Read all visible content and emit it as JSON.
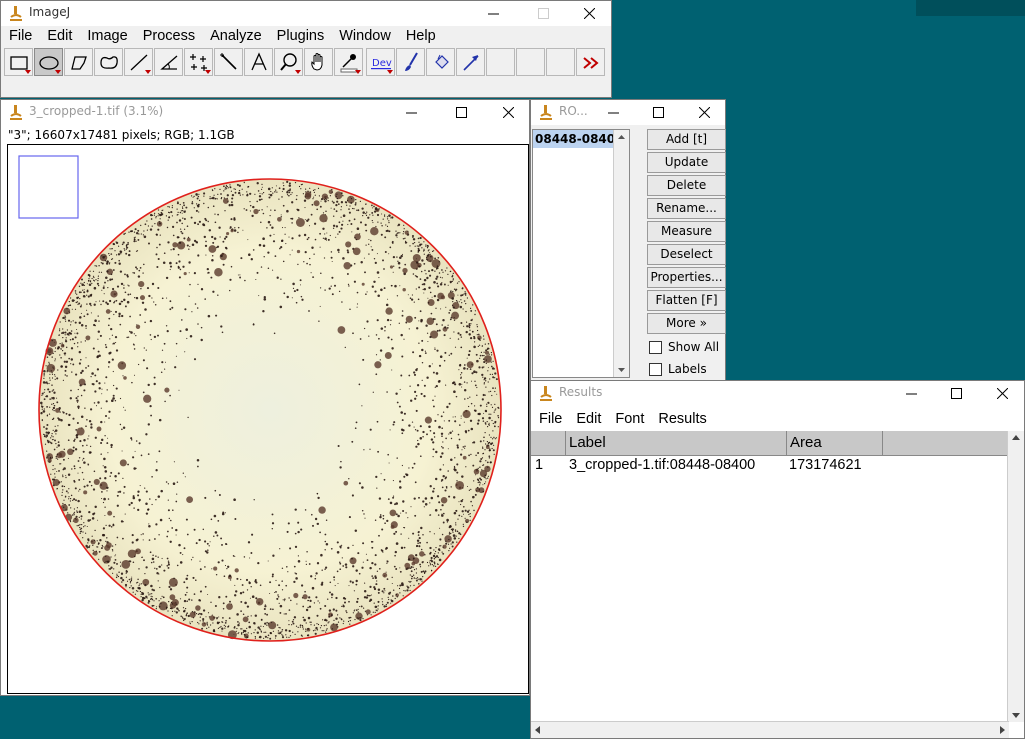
{
  "imagej": {
    "title": "ImageJ",
    "menu": [
      "File",
      "Edit",
      "Image",
      "Process",
      "Analyze",
      "Plugins",
      "Window",
      "Help"
    ],
    "tools": [
      {
        "icon": "rectangle-tool-icon"
      },
      {
        "icon": "oval-tool-icon",
        "selected": true
      },
      {
        "icon": "polygon-tool-icon"
      },
      {
        "icon": "freehand-tool-icon"
      },
      {
        "icon": "line-tool-icon"
      },
      {
        "icon": "angle-tool-icon"
      },
      {
        "icon": "multipoint-tool-icon"
      },
      {
        "icon": "wand-tool-icon"
      },
      {
        "icon": "text-tool-icon"
      },
      {
        "icon": "magnifier-tool-icon"
      },
      {
        "icon": "hand-tool-icon"
      },
      {
        "icon": "color-picker-tool-icon"
      },
      {
        "icon": "developer-menu-icon",
        "label": "Dev"
      },
      {
        "icon": "brush-tool-icon"
      },
      {
        "icon": "flood-fill-tool-icon"
      },
      {
        "icon": "arrow-tool-icon"
      },
      {
        "icon": "empty-slot"
      },
      {
        "icon": "empty-slot"
      },
      {
        "icon": "empty-slot"
      },
      {
        "icon": "more-tools-icon"
      }
    ]
  },
  "image_window": {
    "title": "3_cropped-1.tif (3.1%)",
    "info": "\"3\"; 16607x17481 pixels; RGB; 1.1GB"
  },
  "roi_manager": {
    "title": "RO...",
    "items": [
      "08448-08400"
    ],
    "buttons": [
      "Add [t]",
      "Update",
      "Delete",
      "Rename...",
      "Measure",
      "Deselect",
      "Properties...",
      "Flatten [F]",
      "More »"
    ],
    "checkboxes": [
      "Show All",
      "Labels"
    ]
  },
  "results": {
    "title": "Results",
    "menu": [
      "File",
      "Edit",
      "Font",
      "Results"
    ],
    "columns": [
      "",
      "Label",
      "Area"
    ],
    "rows": [
      {
        "index": "1",
        "label": "3_cropped-1.tif:08448-08400",
        "area": "173174621"
      }
    ]
  },
  "colors": {
    "desktop": "#006171",
    "roi_outline": "#e0201c",
    "specimen_fill": "#f4f1d6",
    "selection_highlight": "#bcd3f0"
  }
}
